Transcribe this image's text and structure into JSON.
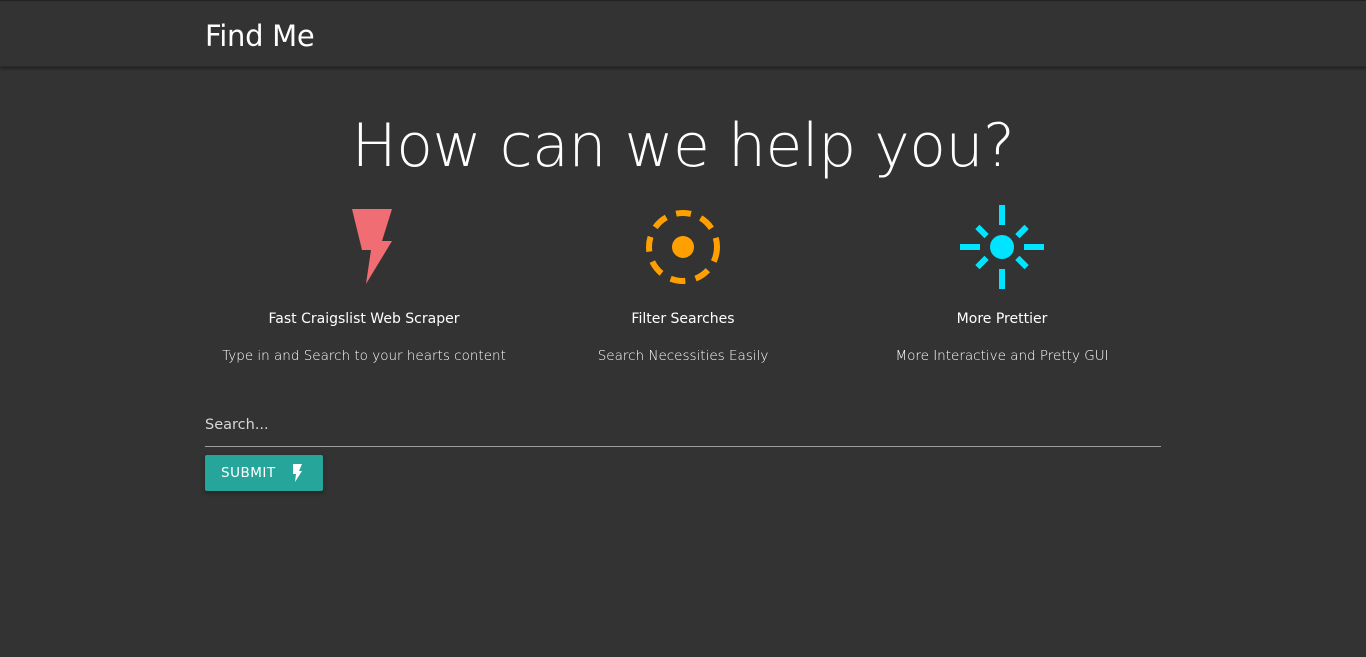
{
  "navbar": {
    "brand": "Find Me"
  },
  "hero": {
    "title": "How can we help you?"
  },
  "features": [
    {
      "icon": "flash-icon",
      "icon_color": "#f06d74",
      "title": "Fast Craigslist Web Scraper",
      "description": "Type in and Search to your hearts content"
    },
    {
      "icon": "gps-target-icon",
      "icon_color": "#ffa000",
      "title": "Filter Searches",
      "description": "Search Necessities Easily"
    },
    {
      "icon": "brightness-icon",
      "icon_color": "#00e5ff",
      "title": "More Prettier",
      "description": "More Interactive and Pretty GUI"
    }
  ],
  "search": {
    "placeholder": "Search...",
    "value": ""
  },
  "submit": {
    "label": "Submit",
    "icon": "flash-icon",
    "color": "#26a69a"
  },
  "colors": {
    "background": "#333333",
    "text": "#ffffff"
  }
}
